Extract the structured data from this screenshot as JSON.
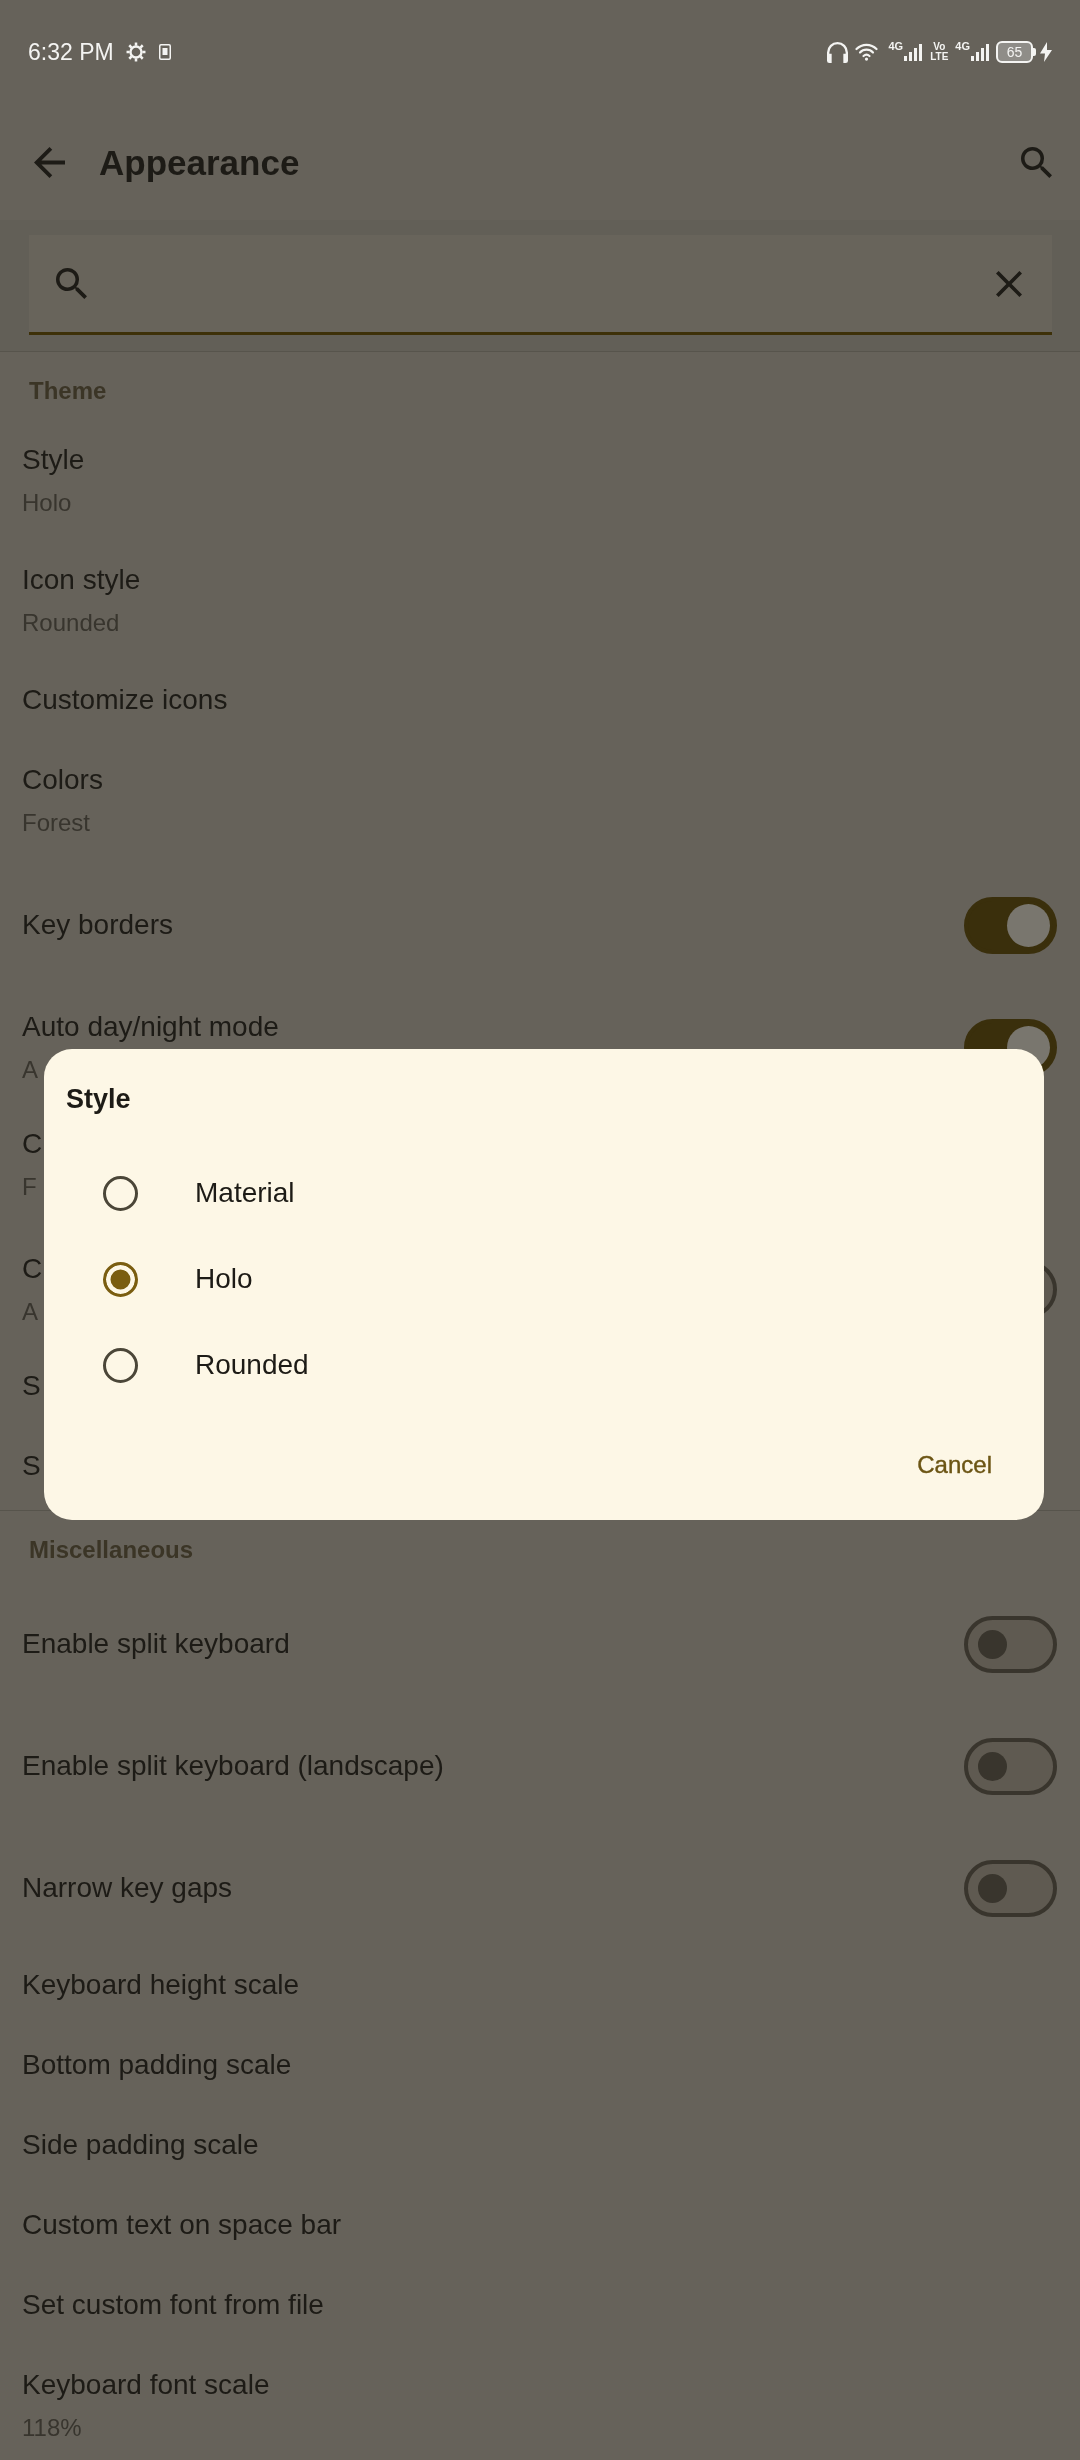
{
  "status_bar": {
    "time": "6:32 PM",
    "sims": [
      {
        "network": "4G"
      },
      {
        "volte": "Vo LTE",
        "network": "4G"
      }
    ],
    "battery": "65",
    "charging": true
  },
  "app_bar": {
    "title": "Appearance"
  },
  "search": {
    "focused": true
  },
  "sections": [
    {
      "title": "Theme",
      "items": [
        {
          "kind": "text",
          "title": "Style",
          "summary": "Holo"
        },
        {
          "kind": "text",
          "title": "Icon style",
          "summary": "Rounded"
        },
        {
          "kind": "text",
          "title": "Customize icons"
        },
        {
          "kind": "text",
          "title": "Colors",
          "summary": "Forest"
        },
        {
          "kind": "toggle",
          "title": "Key borders",
          "on": true
        },
        {
          "kind": "toggle",
          "title": "Auto day/night mode",
          "summary": "A",
          "on": true
        },
        {
          "kind": "text",
          "title": "C",
          "summary": "F"
        },
        {
          "kind": "toggle",
          "title": "C",
          "summary": "A",
          "on": false
        },
        {
          "kind": "text",
          "title": "S"
        },
        {
          "kind": "text",
          "title": "S"
        }
      ]
    },
    {
      "title": "Miscellaneous",
      "items": [
        {
          "kind": "toggle",
          "title": "Enable split keyboard",
          "on": false
        },
        {
          "kind": "toggle",
          "title": "Enable split keyboard (landscape)",
          "on": false
        },
        {
          "kind": "toggle",
          "title": "Narrow key gaps",
          "on": false
        },
        {
          "kind": "text",
          "title": "Keyboard height scale"
        },
        {
          "kind": "text",
          "title": "Bottom padding scale"
        },
        {
          "kind": "text",
          "title": "Side padding scale"
        },
        {
          "kind": "text",
          "title": "Custom text on space bar"
        },
        {
          "kind": "text",
          "title": "Set custom font from file"
        },
        {
          "kind": "text",
          "title": "Keyboard font scale",
          "summary": "118%"
        }
      ]
    }
  ],
  "dialog": {
    "title": "Style",
    "options": [
      {
        "label": "Material",
        "selected": false
      },
      {
        "label": "Holo",
        "selected": true
      },
      {
        "label": "Rounded",
        "selected": false
      }
    ],
    "buttons": [
      {
        "label": "Cancel"
      }
    ]
  }
}
